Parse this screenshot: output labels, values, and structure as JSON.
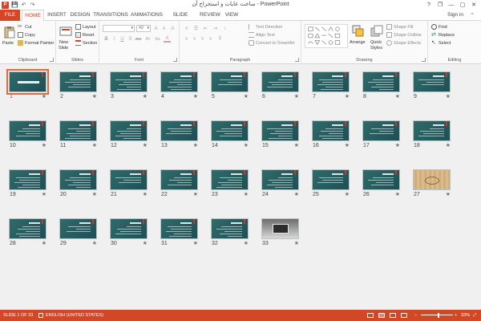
{
  "app": {
    "logo": "P",
    "title": "ساخت عایات و استخراج آن - PowerPoint"
  },
  "window": {
    "help": "?",
    "restore": "❐",
    "minimize": "—",
    "maximize": "▢",
    "close": "✕"
  },
  "qat": {
    "save": "💾",
    "undo": "↶",
    "redo": "↷"
  },
  "tabs": [
    "FILE",
    "HOME",
    "INSERT",
    "DESIGN",
    "TRANSITIONS",
    "ANIMATIONS",
    "SLIDE SHOW",
    "REVIEW",
    "VIEW"
  ],
  "active_tab": "HOME",
  "account": {
    "signin": "Sign in"
  },
  "ribbon": {
    "clipboard": {
      "label": "Clipboard",
      "paste": "Paste",
      "cut": "Cut",
      "copy": "Copy",
      "format_painter": "Format Painter"
    },
    "slides": {
      "label": "Slides",
      "new_slide_1": "New",
      "new_slide_2": "Slide",
      "layout": "Layout",
      "reset": "Reset",
      "section": "Section"
    },
    "font": {
      "label": "Font",
      "size": "42",
      "bold": "B",
      "italic": "I",
      "underline": "U",
      "strike": "S",
      "shadow": "abc",
      "spacing": "AV",
      "case": "Aa",
      "color": "A",
      "grow": "A",
      "shrink": "A",
      "clear": "A"
    },
    "paragraph": {
      "label": "Paragraph",
      "text_direction": "Text Direction",
      "align_text": "Align Text",
      "smartart": "Convert to SmartArt"
    },
    "drawing": {
      "label": "Drawing",
      "arrange": "Arrange",
      "quick_styles_1": "Quick",
      "quick_styles_2": "Styles",
      "shape_fill": "Shape Fill",
      "shape_outline": "Shape Outline",
      "shape_effects": "Shape Effects"
    },
    "editing": {
      "label": "Editing",
      "find": "Find",
      "replace": "Replace",
      "select": "Select"
    }
  },
  "slides": [
    {
      "num": "1",
      "kind": "title",
      "selected": true
    },
    {
      "num": "2"
    },
    {
      "num": "3"
    },
    {
      "num": "4"
    },
    {
      "num": "5"
    },
    {
      "num": "6"
    },
    {
      "num": "7"
    },
    {
      "num": "8"
    },
    {
      "num": "9"
    },
    {
      "num": "10"
    },
    {
      "num": "11"
    },
    {
      "num": "12"
    },
    {
      "num": "13"
    },
    {
      "num": "14"
    },
    {
      "num": "15"
    },
    {
      "num": "16"
    },
    {
      "num": "17"
    },
    {
      "num": "18"
    },
    {
      "num": "19"
    },
    {
      "num": "20"
    },
    {
      "num": "21"
    },
    {
      "num": "22"
    },
    {
      "num": "23"
    },
    {
      "num": "24"
    },
    {
      "num": "25"
    },
    {
      "num": "26"
    },
    {
      "num": "27",
      "kind": "wood"
    },
    {
      "num": "28"
    },
    {
      "num": "29"
    },
    {
      "num": "30"
    },
    {
      "num": "31"
    },
    {
      "num": "32"
    },
    {
      "num": "33",
      "kind": "photo"
    }
  ],
  "star_glyph": "★",
  "status": {
    "slide": "SLIDE 1 OF 33",
    "language": "ENGLISH (UNITED STATES)",
    "zoom": "33%",
    "zoom_minus": "−",
    "zoom_plus": "+",
    "fit": "⤢",
    "zoom_fraction": 0.55
  }
}
